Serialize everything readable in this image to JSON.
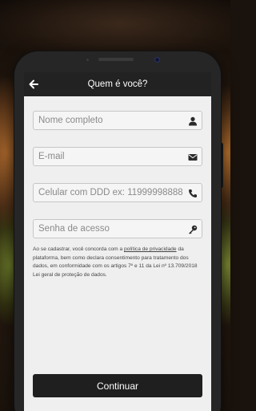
{
  "header": {
    "title": "Quem é você?",
    "back_icon": "arrow-left-icon"
  },
  "form": {
    "name": {
      "placeholder": "Nome completo",
      "icon": "user-icon"
    },
    "email": {
      "placeholder": "E-mail",
      "icon": "envelope-icon"
    },
    "phone": {
      "placeholder": "Celular com DDD ex: 11999998888",
      "icon": "phone-icon"
    },
    "password": {
      "placeholder": "Senha de acesso",
      "icon": "key-icon"
    }
  },
  "terms": {
    "prefix": "Ao se cadastrar, você concorda com a ",
    "link": "política de privacidade",
    "suffix": " da plataforma, bem como declara consentimento para tratamento dos dados, em conformidade com os artigos 7º e 11 da Lei nº 13.709/2018 Lei geral de proteção de dados."
  },
  "actions": {
    "continue_label": "Continuar"
  },
  "colors": {
    "header_bg": "#222222",
    "screen_bg": "#efefef",
    "button_bg": "#1f1f1f"
  }
}
